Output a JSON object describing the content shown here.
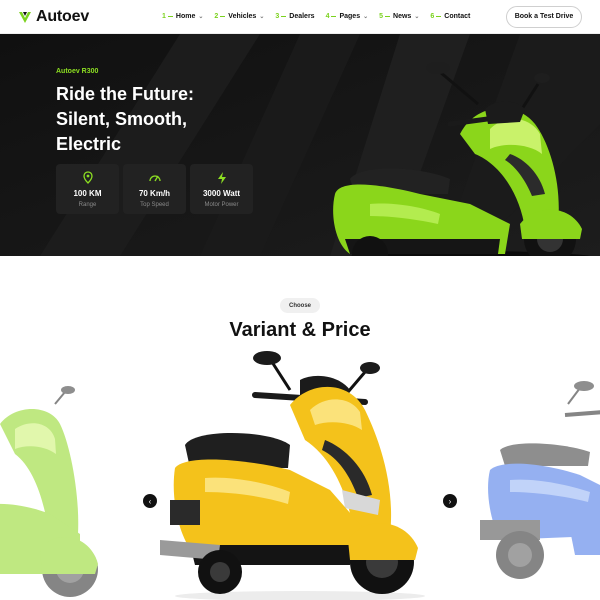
{
  "brand": {
    "name": "Autoev"
  },
  "nav": [
    {
      "num": "1",
      "label": "Home",
      "has_dropdown": true
    },
    {
      "num": "2",
      "label": "Vehicles",
      "has_dropdown": true
    },
    {
      "num": "3",
      "label": "Dealers",
      "has_dropdown": false
    },
    {
      "num": "4",
      "label": "Pages",
      "has_dropdown": true
    },
    {
      "num": "5",
      "label": "News",
      "has_dropdown": true
    },
    {
      "num": "6",
      "label": "Contact",
      "has_dropdown": false
    }
  ],
  "header": {
    "cta_label": "Book a Test Drive"
  },
  "hero": {
    "eyebrow": "Autoev R300",
    "title_lines": [
      "Ride the Future:",
      "Silent, Smooth,",
      "Electric"
    ],
    "stats": [
      {
        "icon": "map-pin-icon",
        "value": "100 KM",
        "label": "Range"
      },
      {
        "icon": "speedometer-icon",
        "value": "70 Km/h",
        "label": "Top Speed"
      },
      {
        "icon": "lightning-icon",
        "value": "3000 Watt",
        "label": "Motor Power"
      }
    ]
  },
  "variant": {
    "pill": "Choose",
    "title": "Variant & Price",
    "prev_icon": "chevron-left-icon",
    "next_icon": "chevron-right-icon"
  },
  "colors": {
    "accent": "#7bd21e",
    "hero_bg": "#161616",
    "scooter_green": "#8bd61b",
    "scooter_yellow": "#f4c21b",
    "scooter_blue": "#3f70e6"
  }
}
